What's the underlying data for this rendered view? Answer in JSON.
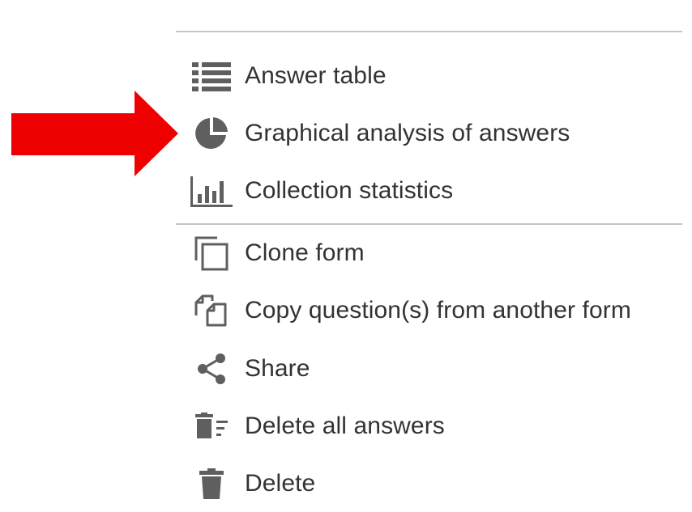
{
  "menu": {
    "items": [
      {
        "label": "Answer table",
        "icon": "table-list-icon"
      },
      {
        "label": "Graphical analysis of answers",
        "icon": "pie-chart-icon"
      },
      {
        "label": "Collection statistics",
        "icon": "bar-chart-icon"
      },
      {
        "label": "Clone form",
        "icon": "clone-icon"
      },
      {
        "label": "Copy question(s) from another form",
        "icon": "copy-pages-icon"
      },
      {
        "label": "Share",
        "icon": "share-icon"
      },
      {
        "label": "Delete all answers",
        "icon": "delete-sweep-icon"
      },
      {
        "label": "Delete",
        "icon": "trash-icon"
      }
    ]
  },
  "colors": {
    "icon": "#5f5f5f",
    "text": "#333333",
    "divider": "#c4c4c4",
    "arrow": "#ee0000"
  }
}
